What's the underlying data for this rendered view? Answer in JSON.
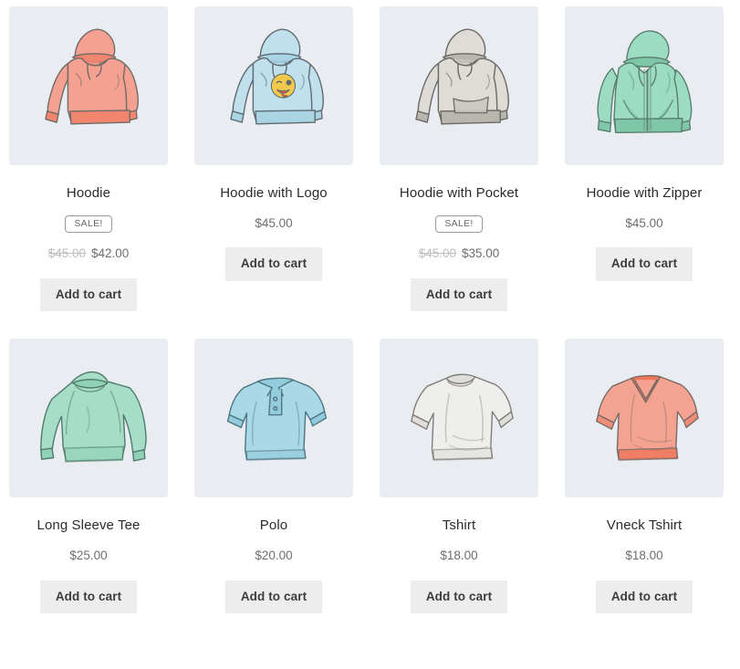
{
  "shop": {
    "columns": 4,
    "add_to_cart_label": "Add to cart",
    "sale_badge_label": "SALE!",
    "tile_background": "#e9edf1",
    "button_background": "#ededed",
    "products": [
      {
        "name": "Hoodie",
        "on_sale": true,
        "regular_price": "$45.00",
        "price": "$42.00",
        "image": "hoodie-salmon-illustration",
        "colors": {
          "fabric": "#f5a191",
          "fabric_shade": "#ef8672",
          "trim": "#f2856e",
          "outline": "#6f6a67"
        }
      },
      {
        "name": "Hoodie with Logo",
        "on_sale": false,
        "regular_price": "",
        "price": "$45.00",
        "image": "hoodie-blue-logo-illustration",
        "colors": {
          "fabric": "#bfe0ec",
          "fabric_shade": "#a7d2e3",
          "trim": "#a9d4e4",
          "outline": "#5f6a70",
          "logo": "#f2c94c"
        }
      },
      {
        "name": "Hoodie with Pocket",
        "on_sale": true,
        "regular_price": "$45.00",
        "price": "$35.00",
        "image": "hoodie-gray-pocket-illustration",
        "colors": {
          "fabric": "#dedcd7",
          "fabric_shade": "#cbc8c2",
          "trim": "#b9b6b0",
          "outline": "#6b6864"
        }
      },
      {
        "name": "Hoodie with Zipper",
        "on_sale": false,
        "regular_price": "",
        "price": "$45.00",
        "image": "hoodie-mint-zipper-illustration",
        "colors": {
          "fabric": "#9bdcc2",
          "fabric_shade": "#83cfb1",
          "trim": "#7ec7a8",
          "outline": "#5b7d70"
        }
      },
      {
        "name": "Long Sleeve Tee",
        "on_sale": false,
        "regular_price": "",
        "price": "$25.00",
        "image": "longsleeve-mint-illustration",
        "colors": {
          "fabric": "#a6ddc8",
          "fabric_shade": "#8fd2b8",
          "trim": "#7cc6aa",
          "outline": "#4f7a69"
        }
      },
      {
        "name": "Polo",
        "on_sale": false,
        "regular_price": "",
        "price": "$20.00",
        "image": "polo-blue-illustration",
        "colors": {
          "fabric": "#a9d8e6",
          "fabric_shade": "#93ccdd",
          "trim": "#86c3d6",
          "outline": "#4e7683"
        }
      },
      {
        "name": "Tshirt",
        "on_sale": false,
        "regular_price": "",
        "price": "$18.00",
        "image": "tshirt-white-illustration",
        "colors": {
          "fabric": "#eeeeec",
          "fabric_shade": "#dfded9",
          "trim": "#d2d0cb",
          "outline": "#807d79"
        }
      },
      {
        "name": "Vneck Tshirt",
        "on_sale": false,
        "regular_price": "",
        "price": "$18.00",
        "image": "vneck-tshirt-salmon-illustration",
        "colors": {
          "fabric": "#f5a391",
          "fabric_shade": "#ef8d78",
          "trim": "#f07659",
          "outline": "#7a6a66"
        }
      }
    ]
  }
}
